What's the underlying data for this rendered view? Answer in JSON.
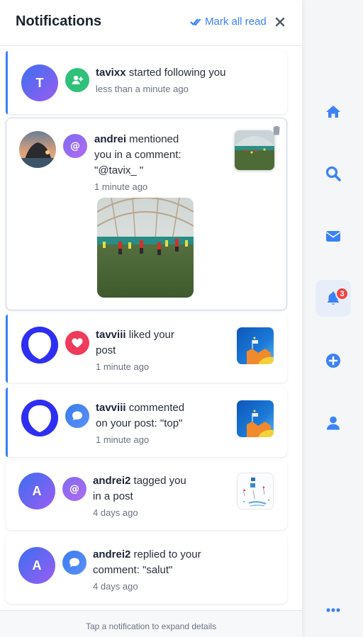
{
  "header": {
    "title": "Notifications",
    "mark_all_read": "Mark all read"
  },
  "notifications": [
    {
      "user": "tavixx",
      "avatar_letter": "T",
      "action": " started following you",
      "time": "less than a minute ago",
      "type_icon": "user-plus-icon",
      "unread": true
    },
    {
      "user": "andrei",
      "action_line1": " mentioned",
      "action_line2": "you in a comment:",
      "action_line3": "\"@tavix_ \"",
      "time": "1 minute ago",
      "type_icon": "at-sign-icon",
      "thumbnail": "soccer-field-photo",
      "expanded": true
    },
    {
      "user": "tavviii",
      "action_line1": " liked your",
      "action_line2": "post",
      "time": "1 minute ago",
      "type_icon": "heart-icon",
      "thumbnail": "blue-flag-image",
      "unread": true
    },
    {
      "user": "tavviii",
      "action_line1": " commented",
      "action_line2": "on your post: \"top\"",
      "time": "1 minute ago",
      "type_icon": "comment-icon",
      "thumbnail": "blue-flag-image",
      "unread": true
    },
    {
      "user": "andrei2",
      "avatar_letter": "A",
      "action_line1": " tagged you",
      "action_line2": "in a post",
      "time": "4 days ago",
      "type_icon": "at-sign-icon",
      "thumbnail": "sketch-image"
    },
    {
      "user": "andrei2",
      "avatar_letter": "A",
      "action_line1": " replied to your",
      "action_line2": "comment: \"salut\"",
      "time": "4 days ago",
      "type_icon": "comment-icon"
    }
  ],
  "sidebar": {
    "items": [
      "home-icon",
      "search-icon",
      "mail-icon",
      "bell-icon",
      "plus-circle-icon",
      "user-icon",
      "more-icon"
    ],
    "notification_count": "3"
  },
  "footer": {
    "hint": "Tap a notification to expand details"
  },
  "colors": {
    "accent": "#3b82f6",
    "unread_bar": "#3b82f6",
    "follow_badge": "#2fc07a",
    "like_badge": "#ee3b5a",
    "count_badge": "#ef4444"
  }
}
